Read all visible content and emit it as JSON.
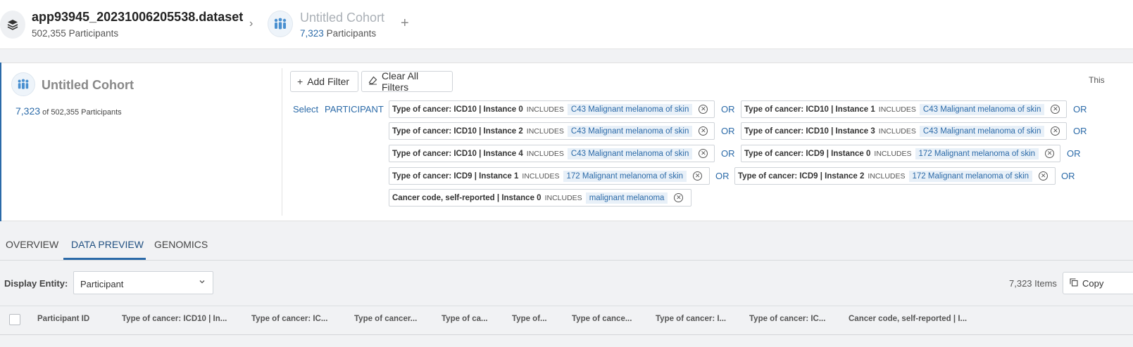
{
  "header": {
    "dataset_name": "app93945_20231006205538.dataset",
    "dataset_count": "502,355",
    "dataset_count_label": "Participants",
    "cohort_name": "Untitled Cohort",
    "cohort_count": "7,323",
    "cohort_count_label": "Participants"
  },
  "cohort_panel": {
    "title": "Untitled Cohort",
    "count": "7,323",
    "of_text": "of 502,355 Participants",
    "add_filter": "Add Filter",
    "clear_filters": "Clear All Filters",
    "truncated_right_text": "This",
    "select_label": "Select",
    "entity_label": "PARTICIPANT",
    "or_label": "OR",
    "includes_label": "INCLUDES",
    "filters": [
      {
        "field": "Type of cancer: ICD10 | Instance 0",
        "value": "C43 Malignant melanoma of skin"
      },
      {
        "field": "Type of cancer: ICD10 | Instance 1",
        "value": "C43 Malignant melanoma of skin"
      },
      {
        "field": "Type of cancer: ICD10 | Instance 2",
        "value": "C43 Malignant melanoma of skin"
      },
      {
        "field": "Type of cancer: ICD10 | Instance 3",
        "value": "C43 Malignant melanoma of skin"
      },
      {
        "field": "Type of cancer: ICD10 | Instance 4",
        "value": "C43 Malignant melanoma of skin"
      },
      {
        "field": "Type of cancer: ICD9 | Instance 0",
        "value": "172 Malignant melanoma of skin"
      },
      {
        "field": "Type of cancer: ICD9 | Instance 1",
        "value": "172 Malignant melanoma of skin"
      },
      {
        "field": "Type of cancer: ICD9 | Instance 2",
        "value": "172 Malignant melanoma of skin"
      },
      {
        "field": "Cancer code, self-reported | Instance 0",
        "value": "malignant melanoma"
      }
    ]
  },
  "tabs": [
    "OVERVIEW",
    "DATA PREVIEW",
    "GENOMICS"
  ],
  "active_tab": "DATA PREVIEW",
  "display_entity": {
    "label": "Display Entity:",
    "value": "Participant"
  },
  "items_count": "7,323 Items",
  "copy_label": "Copy",
  "columns": [
    "Participant ID",
    "Type of cancer: ICD10 | In...",
    "Type of cancer: IC...",
    "Type of cancer...",
    "Type of ca...",
    "Type of...",
    "Type of cance...",
    "Type of cancer: I...",
    "Type of cancer: IC...",
    "Cancer code, self-reported | I..."
  ],
  "colors": {
    "accent": "#2b6aa8",
    "chip_value_bg": "#e8f0f8",
    "panel_bg": "#f1f2f4"
  }
}
